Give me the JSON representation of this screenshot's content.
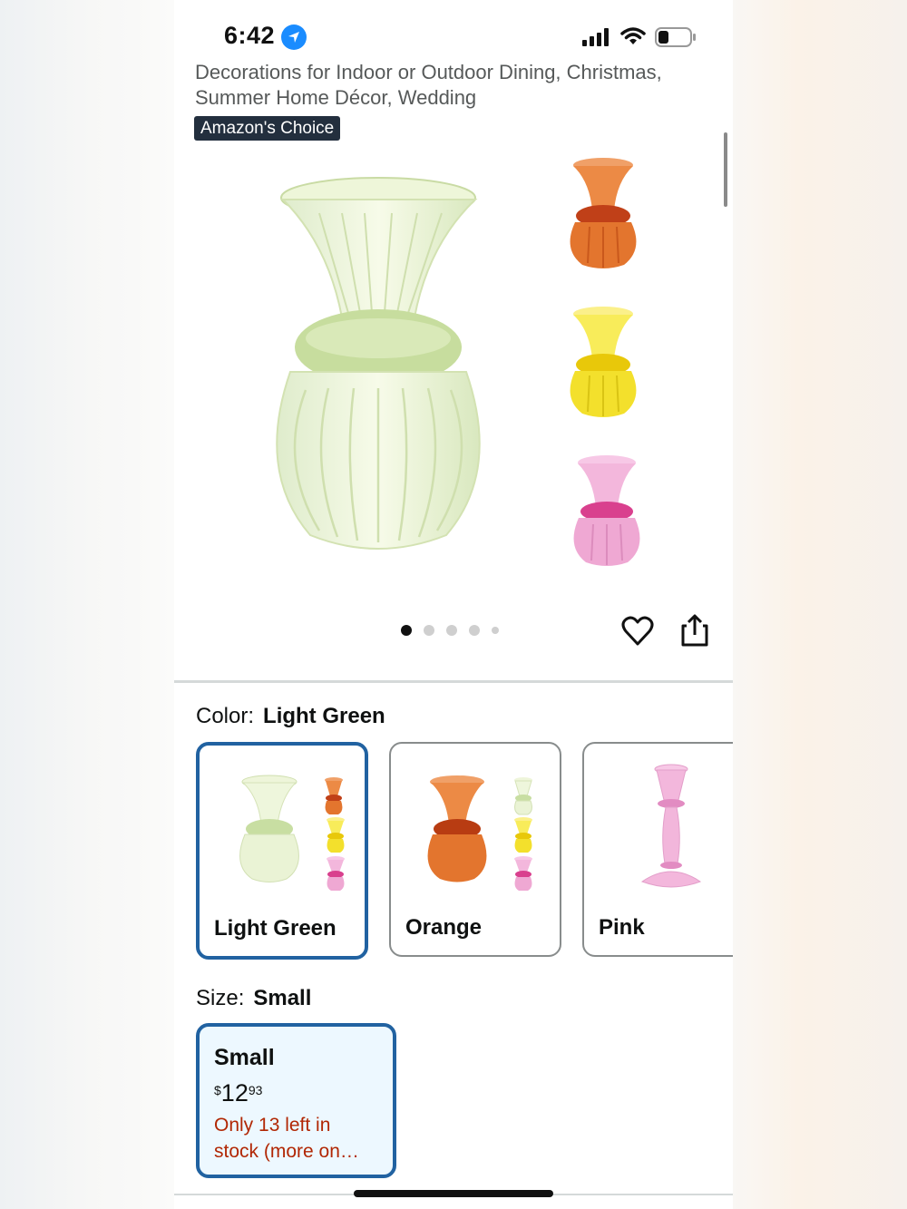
{
  "status_bar": {
    "time": "6:42",
    "icons": [
      "location-arrow-icon",
      "cellular-signal-icon",
      "wifi-icon",
      "battery-icon"
    ]
  },
  "product": {
    "title_line1": "Decorations for Indoor or Outdoor Dining, Christmas,",
    "title_line2": "Summer Home Décor, Wedding",
    "badge": "Amazon's Choice"
  },
  "gallery": {
    "dots_count": 5,
    "active_index": 0,
    "actions": [
      "heart-icon",
      "share-icon"
    ]
  },
  "color_selector": {
    "label": "Color:",
    "selected": "Light Green",
    "options": [
      {
        "label": "Light Green",
        "selected": true
      },
      {
        "label": "Orange",
        "selected": false
      },
      {
        "label": "Pink",
        "selected": false
      }
    ]
  },
  "size_selector": {
    "label": "Size:",
    "selected": "Small",
    "options": [
      {
        "name": "Small",
        "currency": "$",
        "price_whole": "12",
        "price_fraction": "93",
        "stock_line1": "Only 13 left in",
        "stock_line2": "stock (more on…"
      }
    ]
  },
  "colors": {
    "accent_blue": "#2162a1",
    "stock_red": "#b12704",
    "badge_bg": "#232f3e",
    "light_green": "#e8f2c9",
    "orange": "#e8742a",
    "yellow": "#f5e62a",
    "pink": "#f0a9d6"
  }
}
